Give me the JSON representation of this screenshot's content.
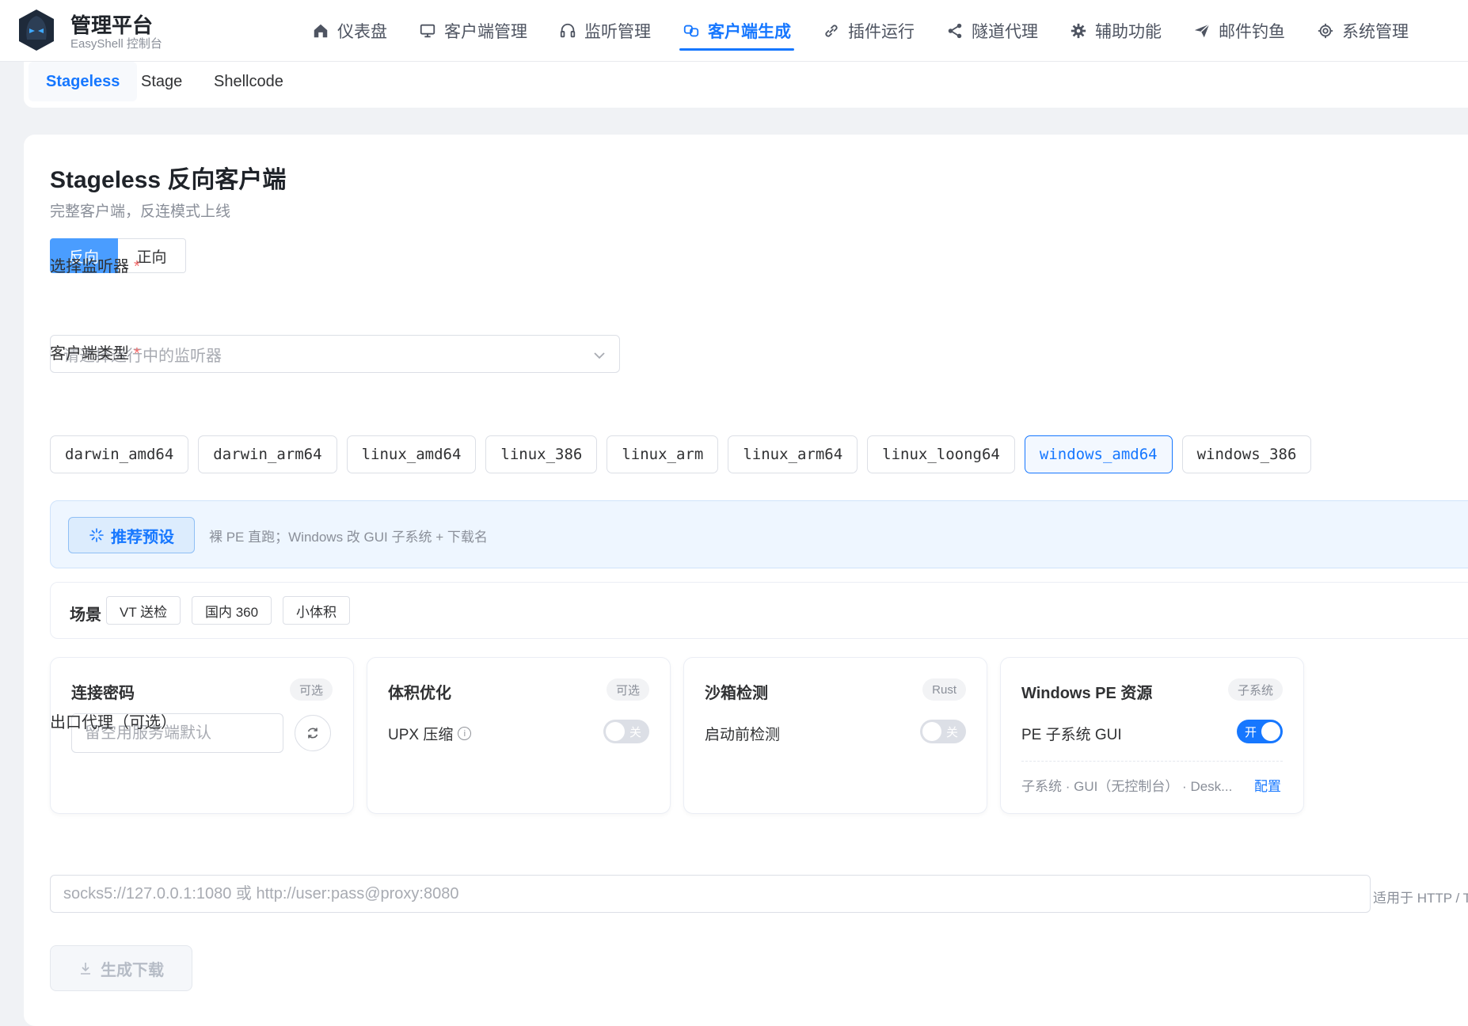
{
  "header": {
    "title": "管理平台",
    "subtitle": "EasyShell 控制台",
    "nav": [
      {
        "label": "仪表盘",
        "icon": "home-icon"
      },
      {
        "label": "客户端管理",
        "icon": "monitor-icon"
      },
      {
        "label": "监听管理",
        "icon": "headset-icon"
      },
      {
        "label": "客户端生成",
        "icon": "link-box-icon",
        "active": true
      },
      {
        "label": "插件运行",
        "icon": "link-icon"
      },
      {
        "label": "隧道代理",
        "icon": "share-icon"
      },
      {
        "label": "辅助功能",
        "icon": "cog-icon"
      },
      {
        "label": "邮件钓鱼",
        "icon": "send-icon"
      },
      {
        "label": "系统管理",
        "icon": "settings-icon"
      }
    ]
  },
  "mode_tabs": [
    "Stageless",
    "Stage",
    "Shellcode"
  ],
  "main": {
    "title": "Stageless 反向客户端",
    "subtitle": "完整客户端，反连模式上线",
    "direction": [
      "反向",
      "正向"
    ],
    "listener_label": "选择监听器",
    "listener_placeholder": "请选择运行中的监听器",
    "type_label": "客户端类型",
    "required_mark": "*",
    "types": [
      "darwin_amd64",
      "darwin_arm64",
      "linux_amd64",
      "linux_386",
      "linux_arm",
      "linux_arm64",
      "linux_loong64",
      "windows_amd64",
      "windows_386"
    ],
    "selected_type": "windows_amd64",
    "preset_button": "推荐预设",
    "preset_desc": "裸 PE 直跑；Windows 改 GUI 子系统 + 下载名",
    "scene_label": "场景",
    "scenes": [
      "VT 送检",
      "国内 360",
      "小体积"
    ],
    "cards": {
      "password": {
        "title": "连接密码",
        "badge": "可选",
        "placeholder": "留空用服务端默认"
      },
      "size": {
        "title": "体积优化",
        "badge": "可选",
        "row": "UPX 压缩",
        "info": "i",
        "toggle": "关"
      },
      "sandbox": {
        "title": "沙箱检测",
        "badge": "Rust",
        "row": "启动前检测",
        "toggle": "关"
      },
      "pe": {
        "title": "Windows PE 资源",
        "badge": "子系统",
        "row": "PE 子系统 GUI",
        "toggle": "开",
        "info": "子系统 · GUI（无控制台） · Desk...",
        "link": "配置"
      }
    },
    "proxy_label": "出口代理（可选）",
    "proxy_placeholder": "socks5://127.0.0.1:1080 或 http://user:pass@proxy:8080",
    "proxy_hint": "适用于 HTTP / T",
    "generate_button": "生成下载"
  },
  "colors": {
    "accent": "#1677ff",
    "required": "#f56c6c"
  }
}
